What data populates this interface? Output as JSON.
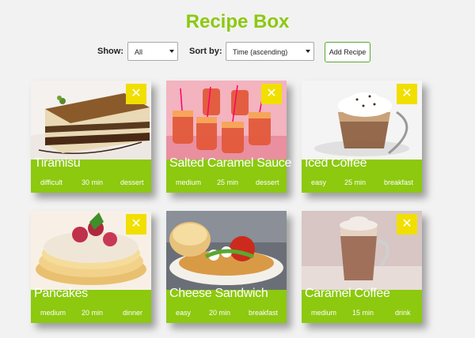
{
  "app": {
    "title": "Recipe Box"
  },
  "controls": {
    "show_label": "Show:",
    "show_value": "All",
    "sort_label": "Sort by:",
    "sort_value": "Time (ascending)",
    "add_button": "Add Recipe"
  },
  "recipes": [
    {
      "name": "Tiramisu",
      "difficulty": "difficult",
      "time": "30 min",
      "category": "dessert"
    },
    {
      "name": "Salted Caramel Sauce",
      "difficulty": "medium",
      "time": "25 min",
      "category": "dessert"
    },
    {
      "name": "Iced Coffee",
      "difficulty": "easy",
      "time": "25 min",
      "category": "breakfast"
    },
    {
      "name": "Pancakes",
      "difficulty": "medium",
      "time": "20 min",
      "category": "dinner"
    },
    {
      "name": "Cheese Sandwich",
      "difficulty": "easy",
      "time": "20 min",
      "category": "breakfast"
    },
    {
      "name": "Caramel Coffee",
      "difficulty": "medium",
      "time": "15 min",
      "category": "drink"
    }
  ],
  "icons": {
    "close": "close-icon"
  },
  "colors": {
    "accent": "#8cc90f",
    "close_button": "#f1df00",
    "background": "#f2f2f2"
  }
}
